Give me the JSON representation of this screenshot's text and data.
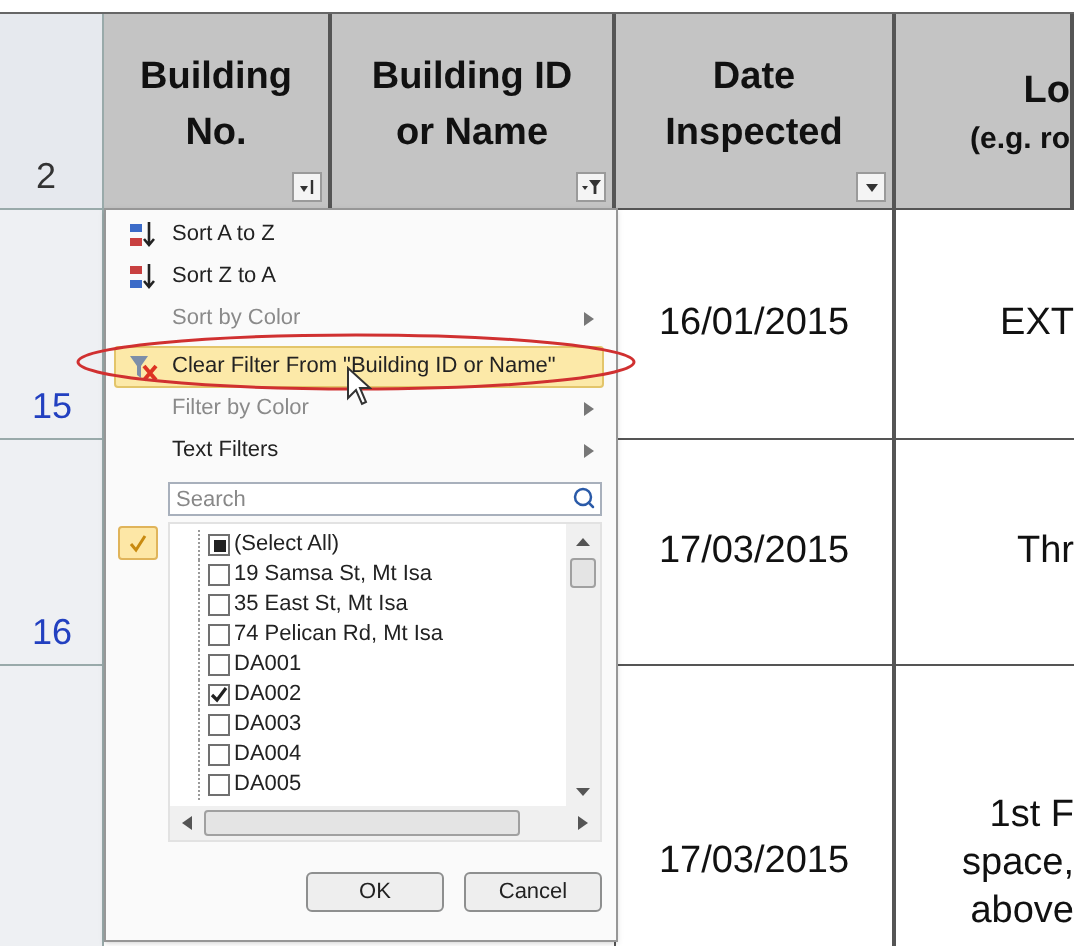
{
  "sheet": {
    "header_row_number": "2",
    "columns": [
      {
        "title": "Building No.",
        "kind": "sorted"
      },
      {
        "title": "Building ID or Name",
        "kind": "filtered"
      },
      {
        "title": "Date Inspected",
        "kind": "plain"
      },
      {
        "title": "Lo",
        "subtitle": "(e.g. ro"
      }
    ],
    "rows": [
      {
        "number": "15",
        "date": "16/01/2015",
        "location": [
          "EXT"
        ]
      },
      {
        "number": "16",
        "date": "17/03/2015",
        "location": [
          "Thr"
        ]
      },
      {
        "date": "17/03/2015",
        "location": [
          "1st F",
          "space,",
          "above"
        ]
      }
    ]
  },
  "filter_menu": {
    "items": [
      {
        "label": "Sort A to Z",
        "kind": "sort-ascending",
        "disabled": false,
        "highlighted": false
      },
      {
        "label": "Sort Z to A",
        "kind": "sort-descending",
        "disabled": false,
        "highlighted": false
      },
      {
        "label": "Sort by Color",
        "kind": "submenu",
        "disabled": true,
        "highlighted": false
      },
      {
        "label": "Clear Filter From \"Building ID or Name\"",
        "kind": "clear-filter",
        "disabled": false,
        "highlighted": true
      },
      {
        "label": "Filter by Color",
        "kind": "submenu",
        "disabled": true,
        "highlighted": false
      },
      {
        "label": "Text Filters",
        "kind": "submenu",
        "disabled": false,
        "highlighted": false
      }
    ],
    "search": {
      "placeholder": "Search"
    },
    "values": [
      {
        "label": "(Select All)",
        "mixed": true
      },
      {
        "label": "19 Samsa St, Mt Isa",
        "checked": false
      },
      {
        "label": "35 East St, Mt Isa",
        "checked": false
      },
      {
        "label": "74 Pelican Rd, Mt Isa",
        "checked": false
      },
      {
        "label": "DA001",
        "checked": false
      },
      {
        "label": "DA002",
        "checked": true
      },
      {
        "label": "DA003",
        "checked": false
      },
      {
        "label": "DA004",
        "checked": false
      },
      {
        "label": "DA005",
        "checked": false
      }
    ],
    "buttons": [
      {
        "label": "OK"
      },
      {
        "label": "Cancel"
      }
    ]
  }
}
